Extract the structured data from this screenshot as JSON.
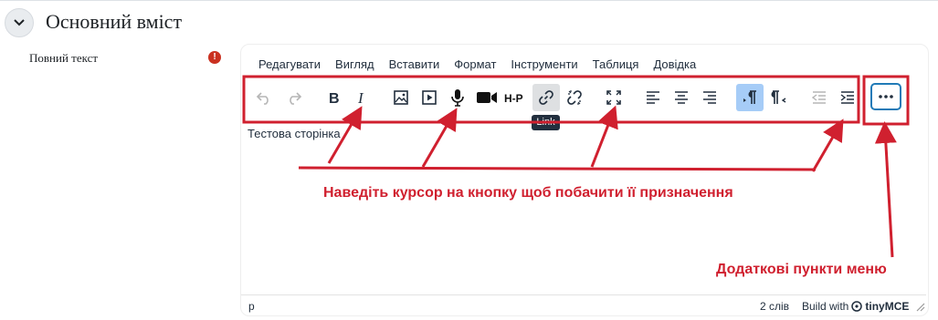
{
  "section": {
    "title": "Основний вміст"
  },
  "field": {
    "label": "Повний текст",
    "required_mark": "!"
  },
  "menubar": [
    "Редагувати",
    "Вигляд",
    "Вставити",
    "Формат",
    "Інструменти",
    "Таблиця",
    "Довідка"
  ],
  "toolbar": {
    "buttons": [
      {
        "icon": "undo-icon"
      },
      {
        "icon": "redo-icon"
      },
      {
        "icon": "bold-icon"
      },
      {
        "icon": "italic-icon"
      },
      {
        "icon": "image-icon"
      },
      {
        "icon": "media-icon"
      },
      {
        "icon": "microphone-icon"
      },
      {
        "icon": "video-camera-icon"
      },
      {
        "icon": "h5p-icon",
        "label": "H-P"
      },
      {
        "icon": "link-icon"
      },
      {
        "icon": "unlink-icon"
      },
      {
        "icon": "fullscreen-icon"
      },
      {
        "icon": "align-left-icon"
      },
      {
        "icon": "align-center-icon"
      },
      {
        "icon": "align-right-icon"
      },
      {
        "icon": "ltr-icon"
      },
      {
        "icon": "rtl-icon"
      },
      {
        "icon": "outdent-icon"
      },
      {
        "icon": "indent-icon"
      },
      {
        "icon": "more-icon"
      }
    ],
    "tooltip": "Link"
  },
  "content": {
    "text": "Тестова сторінка"
  },
  "statusbar": {
    "path": "p",
    "words": "2 слів",
    "build_with": "Build with",
    "brand": "tinyMCE"
  },
  "annotations": {
    "hover_hint": "Наведіть курсор на кнопку щоб побачити її призначення",
    "more_menu_hint": "Додаткові пункти меню",
    "color": "#d0202f"
  },
  "colors": {
    "active_button": "#a6ccf7",
    "tooltip_bg": "#222f3e",
    "required": "#ca3120",
    "focus_border": "#207ab7"
  }
}
